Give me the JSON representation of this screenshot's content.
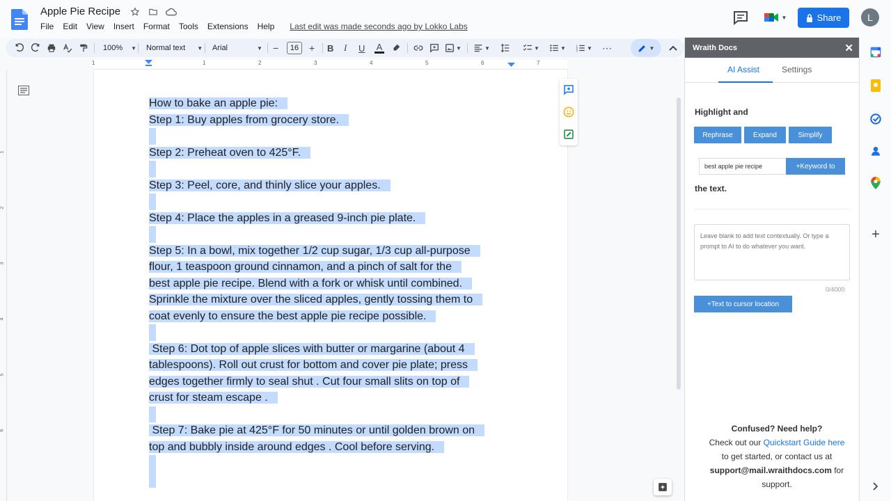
{
  "app": {
    "doc_title": "Apple Pie Recipe",
    "last_edit": "Last edit was made seconds ago by Lokko Labs",
    "share_label": "Share",
    "avatar_initial": "L"
  },
  "menu": [
    "File",
    "Edit",
    "View",
    "Insert",
    "Format",
    "Tools",
    "Extensions",
    "Help"
  ],
  "toolbar": {
    "zoom": "100%",
    "style": "Normal text",
    "font": "Arial",
    "font_size": "16"
  },
  "ruler": {
    "numbers": [
      "1",
      "1",
      "2",
      "3",
      "4",
      "5",
      "6",
      "7"
    ],
    "vertical_numbers": [
      "1",
      "2",
      "3",
      "4",
      "5",
      "6"
    ]
  },
  "document": {
    "lines": [
      "How to bake an apple pie:",
      "Step 1: Buy apples from grocery store.",
      "",
      "Step 2: Preheat oven to 425°F.",
      "",
      "Step 3: Peel, core, and thinly slice your apples.",
      "",
      "Step 4: Place the apples in a greased 9-inch pie plate.",
      "",
      "Step 5: In a bowl, mix together 1/2 cup sugar, 1/3 cup all-purpose",
      "flour, 1 teaspoon ground cinnamon, and a pinch of salt for the",
      "best apple pie recipe. Blend with a fork or whisk until combined.",
      "Sprinkle the mixture over the sliced apples, gently tossing them to",
      "coat evenly to ensure the best apple pie recipe possible.",
      "",
      " Step 6: Dot top of apple slices with butter or margarine (about 4",
      "tablespoons). Roll out crust for bottom and cover pie plate; press",
      "edges together firmly to seal shut . Cut four small slits on top of",
      "crust for steam escape .",
      "",
      " Step 7: Bake pie at 425°F for 50 minutes or until golden brown on",
      "top and bubbly inside around edges . Cool before serving.",
      ""
    ]
  },
  "panel": {
    "title": "Wraith Docs",
    "tabs": [
      "AI Assist",
      "Settings"
    ],
    "highlight_label": "Highlight and",
    "buttons": [
      "Rephrase",
      "Expand",
      "Simplify"
    ],
    "keyword_value": "best apple pie recipe",
    "keyword_button": "+Keyword to",
    "the_text": "the text.",
    "prompt_placeholder": "Leave blank to add text contextually. Or type a prompt to AI to do whatever you want.",
    "counter": "0/4000",
    "cursor_button": "+Text to cursor location",
    "help_title": "Confused? Need help?",
    "help_line1": "Check out our ",
    "help_link": "Quickstart Guide here",
    "help_line2": "to get started, or contact us at",
    "help_email": "support@mail.wraithdocs.com",
    "help_line3a": " for",
    "help_line4": "support."
  },
  "colors": {
    "accent": "#1a73e8",
    "selection": "#c2dbff",
    "panel_button": "#4a90d9",
    "panel_header": "#5f6368"
  }
}
